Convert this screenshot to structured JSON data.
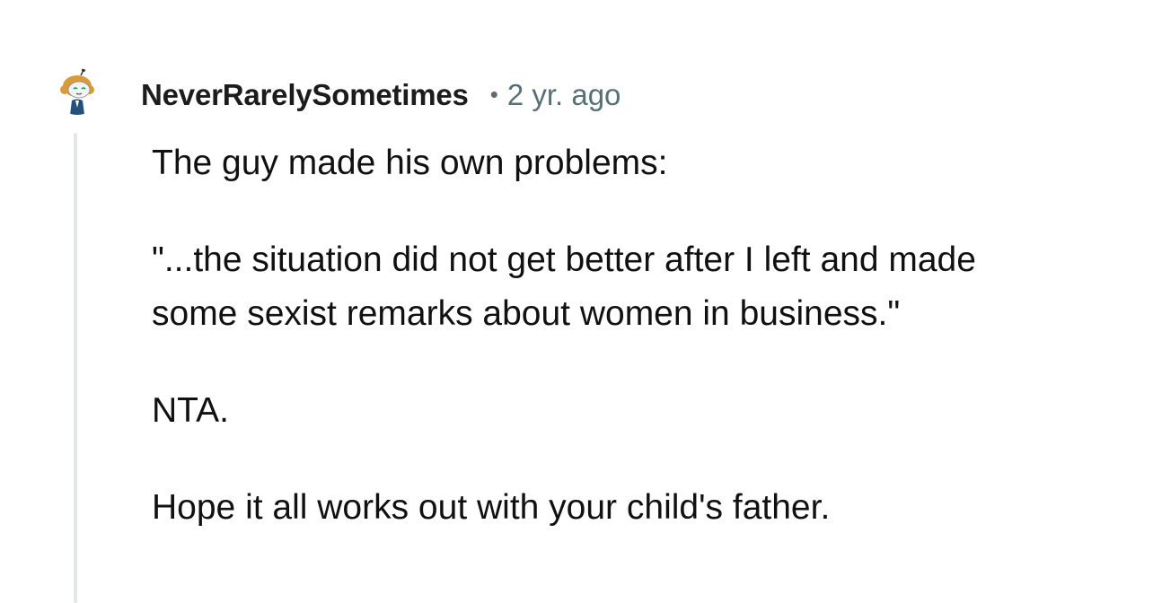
{
  "comment": {
    "username": "NeverRarelySometimes",
    "separator": "•",
    "age": "2 yr. ago",
    "paragraphs": [
      "The guy made his own problems:",
      "\"...the situation did not get better after I left and made some sexist remarks about women in business.\"",
      "NTA.",
      "Hope it all works out with your child's father."
    ]
  },
  "icons": {
    "avatar": "user-avatar-icon"
  }
}
